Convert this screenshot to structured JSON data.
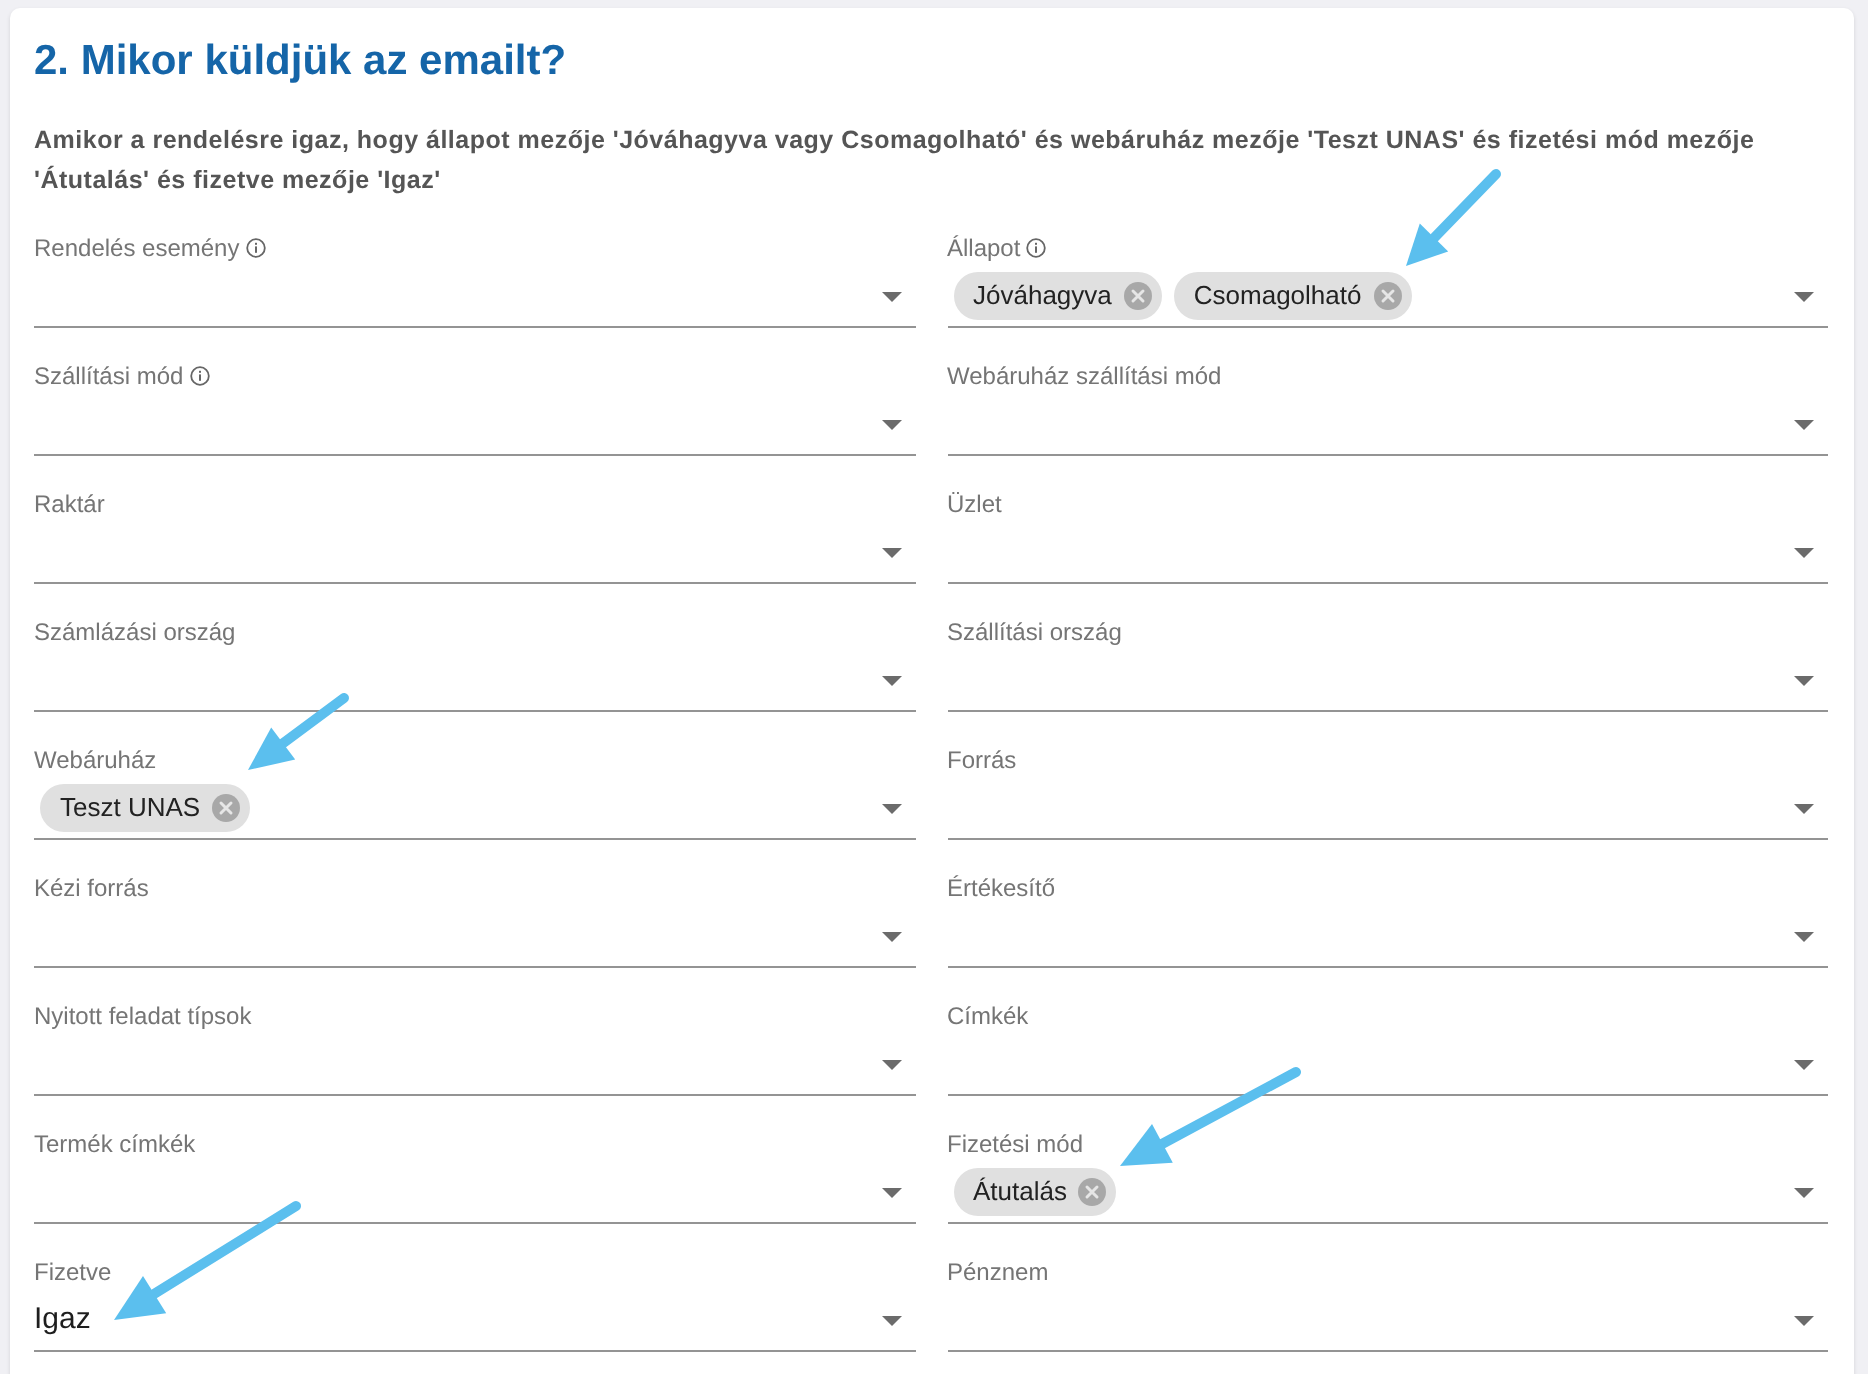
{
  "section": {
    "title": "2. Mikor küldjük az emailt?",
    "description": "Amikor a rendelésre igaz, hogy állapot mezője 'Jóváhagyva vagy Csomagolható' és webáruház mezője 'Teszt UNAS' és fizetési mód mezője 'Átutalás' és fizetve mezője 'Igaz'"
  },
  "fields": [
    {
      "label": "Rendelés esemény",
      "info": true,
      "kind": "empty"
    },
    {
      "label": "Állapot",
      "info": true,
      "kind": "chips",
      "chips": [
        {
          "label": "Jóváhagyva"
        },
        {
          "label": "Csomagolható"
        }
      ]
    },
    {
      "label": "Szállítási mód",
      "info": true,
      "kind": "empty"
    },
    {
      "label": "Webáruház szállítási mód",
      "info": false,
      "kind": "empty"
    },
    {
      "label": "Raktár",
      "info": false,
      "kind": "empty"
    },
    {
      "label": "Üzlet",
      "info": false,
      "kind": "empty"
    },
    {
      "label": "Számlázási ország",
      "info": false,
      "kind": "empty"
    },
    {
      "label": "Szállítási ország",
      "info": false,
      "kind": "empty"
    },
    {
      "label": "Webáruház",
      "info": false,
      "kind": "chips",
      "chips": [
        {
          "label": "Teszt UNAS"
        }
      ]
    },
    {
      "label": "Forrás",
      "info": false,
      "kind": "empty"
    },
    {
      "label": "Kézi forrás",
      "info": false,
      "kind": "empty"
    },
    {
      "label": "Értékesítő",
      "info": false,
      "kind": "empty"
    },
    {
      "label": "Nyitott feladat típsok",
      "info": false,
      "kind": "empty"
    },
    {
      "label": "Címkék",
      "info": false,
      "kind": "empty"
    },
    {
      "label": "Termék címkék",
      "info": false,
      "kind": "empty"
    },
    {
      "label": "Fizetési mód",
      "info": false,
      "kind": "chips",
      "chips": [
        {
          "label": "Átutalás"
        }
      ]
    },
    {
      "label": "Fizetve",
      "info": false,
      "kind": "text",
      "value": "Igaz"
    },
    {
      "label": "Pénznem",
      "info": false,
      "kind": "empty"
    }
  ]
}
